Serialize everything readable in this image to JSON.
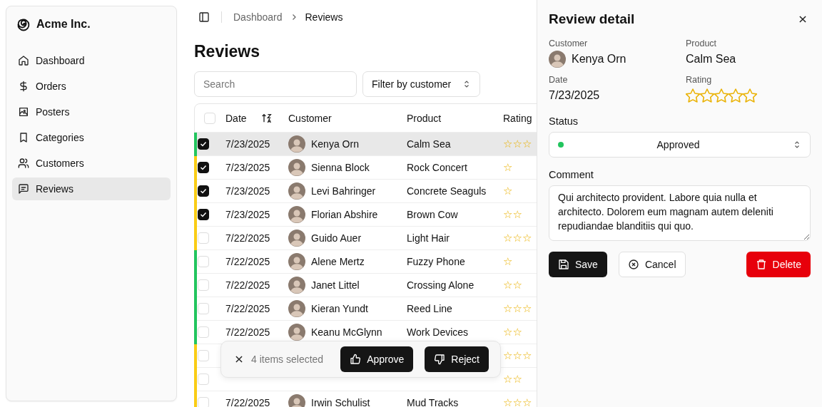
{
  "brand": {
    "name": "Acme Inc."
  },
  "sidebar": {
    "items": [
      {
        "label": "Dashboard",
        "kind": "home",
        "selected": false
      },
      {
        "label": "Orders",
        "kind": "dollar",
        "selected": false
      },
      {
        "label": "Posters",
        "kind": "image",
        "selected": false
      },
      {
        "label": "Categories",
        "kind": "bookmark",
        "selected": false
      },
      {
        "label": "Customers",
        "kind": "users",
        "selected": false
      },
      {
        "label": "Reviews",
        "kind": "message",
        "selected": true
      }
    ]
  },
  "breadcrumb": [
    "Dashboard",
    "Reviews"
  ],
  "page_title": "Reviews",
  "search": {
    "placeholder": "Search"
  },
  "filter": {
    "label": "Filter by customer"
  },
  "table": {
    "columns": [
      "Date",
      "Customer",
      "Product",
      "Rating"
    ],
    "header_checked": false,
    "rows": [
      {
        "checked": true,
        "selected": true,
        "color": "#22c55e",
        "date": "7/23/2025",
        "customer": "Kenya Orn",
        "product": "Calm Sea",
        "rating": "☆☆☆"
      },
      {
        "checked": true,
        "selected": false,
        "color": "#facc15",
        "date": "7/23/2025",
        "customer": "Sienna Block",
        "product": "Rock Concert",
        "rating": "☆"
      },
      {
        "checked": true,
        "selected": false,
        "color": "#facc15",
        "date": "7/23/2025",
        "customer": "Levi Bahringer",
        "product": "Concrete Seaguls",
        "rating": "☆"
      },
      {
        "checked": true,
        "selected": false,
        "color": "#facc15",
        "date": "7/23/2025",
        "customer": "Florian Abshire",
        "product": "Brown Cow",
        "rating": "☆☆"
      },
      {
        "checked": false,
        "selected": false,
        "color": "#facc15",
        "date": "7/22/2025",
        "customer": "Guido Auer",
        "product": "Light Hair",
        "rating": "☆☆☆"
      },
      {
        "checked": false,
        "selected": false,
        "color": "#22c55e",
        "date": "7/22/2025",
        "customer": "Alene Mertz",
        "product": "Fuzzy Phone",
        "rating": "☆"
      },
      {
        "checked": false,
        "selected": false,
        "color": "#22c55e",
        "date": "7/22/2025",
        "customer": "Janet Littel",
        "product": "Crossing Alone",
        "rating": "☆☆"
      },
      {
        "checked": false,
        "selected": false,
        "color": "#22c55e",
        "date": "7/22/2025",
        "customer": "Kieran Yundt",
        "product": "Reed Line",
        "rating": "☆☆☆"
      },
      {
        "checked": false,
        "selected": false,
        "color": "#22c55e",
        "date": "7/22/2025",
        "customer": "Keanu McGlynn",
        "product": "Work Devices",
        "rating": "☆☆"
      },
      {
        "checked": false,
        "selected": false,
        "color": "#facc15",
        "rating": "☆☆☆"
      },
      {
        "checked": false,
        "selected": false,
        "color": "#facc15",
        "rating": "☆☆"
      },
      {
        "checked": false,
        "selected": false,
        "color": "#facc15",
        "date": "7/22/2025",
        "customer": "Irwin Schulist",
        "product": "Mud Tracks",
        "rating": "☆☆☆"
      }
    ]
  },
  "selection_bar": {
    "count_text": "4 items selected",
    "approve": "Approve",
    "reject": "Reject"
  },
  "detail": {
    "title": "Review detail",
    "customer_label": "Customer",
    "customer": "Kenya Orn",
    "product_label": "Product",
    "product": "Calm Sea",
    "date_label": "Date",
    "date": "7/23/2025",
    "rating_label": "Rating",
    "stars": 0,
    "status_label": "Status",
    "status": {
      "label": "Approved",
      "color": "#22c55e"
    },
    "comment_label": "Comment",
    "comment": "Qui architecto provident. Labore quia nulla et architecto. Dolorem eum magnam autem deleniti repudiandae blanditiis qui quo.",
    "save": "Save",
    "cancel": "Cancel",
    "delete": "Delete"
  }
}
